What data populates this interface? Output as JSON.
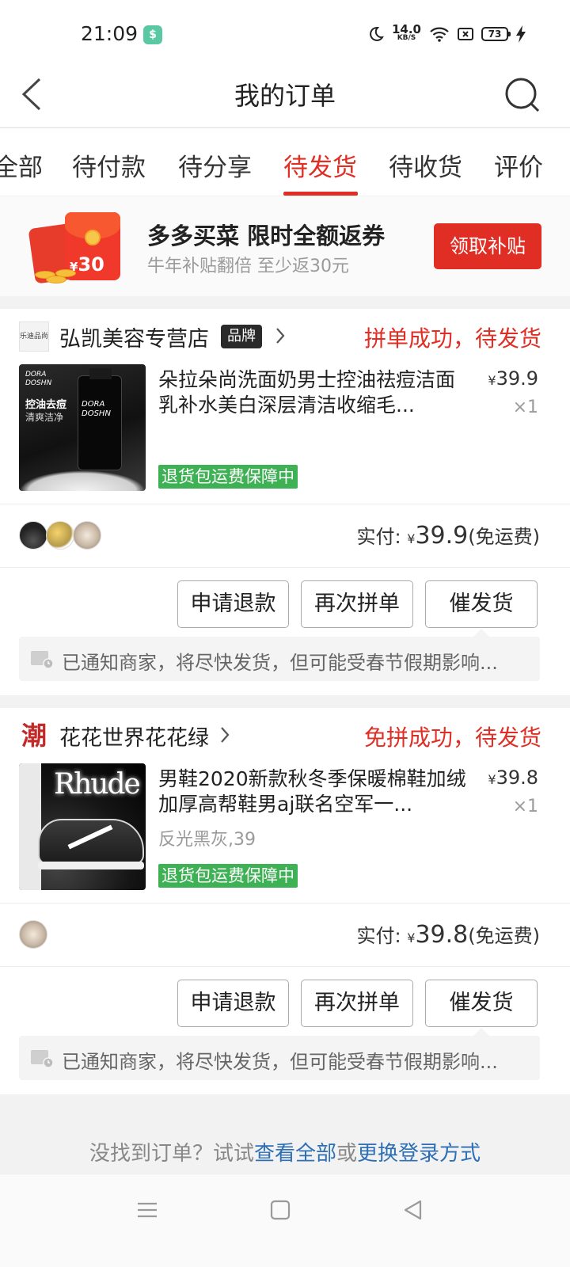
{
  "status_bar": {
    "time": "21:09",
    "net_speed": "14.0",
    "net_unit": "KB/S",
    "battery": "73"
  },
  "header": {
    "title": "我的订单"
  },
  "tabs": [
    {
      "label": "全部",
      "active": false
    },
    {
      "label": "待付款",
      "active": false
    },
    {
      "label": "待分享",
      "active": false
    },
    {
      "label": "待发货",
      "active": true
    },
    {
      "label": "待收货",
      "active": false
    },
    {
      "label": "评价",
      "active": false
    }
  ],
  "promo": {
    "title": "多多买菜 限时全额返券",
    "subtitle": "牛年补贴翻倍 至少返30元",
    "button": "领取补贴",
    "coupon_currency": "¥",
    "coupon_amount": "30"
  },
  "orders": [
    {
      "shop_name": "弘凯美容专营店",
      "shop_logo_text": "乐迪品尚",
      "brand_badge": "品牌",
      "status": "拼单成功，待发货",
      "product_title": "朵拉朵尚洗面奶男士控油祛痘洁面乳补水美白深层清洁收缩毛...",
      "product_image_text": [
        "DORA",
        "DOSHN",
        "控油去痘",
        "清爽洁净"
      ],
      "spec": "",
      "price_currency": "¥",
      "price": "39.9",
      "qty": "×1",
      "guarantee": "退货包运费保障中",
      "paid_label": "实付:",
      "paid_currency": "¥",
      "paid_amount": "39.9",
      "shipping_note": "(免运费)",
      "buttons": [
        "申请退款",
        "再次拼单",
        "催发货"
      ],
      "notice": "已通知商家，将尽快发货，但可能受春节假期影响..."
    },
    {
      "shop_name": "花花世界花花绿",
      "shop_logo_text": "潮",
      "status": "免拼成功，待发货",
      "product_title": "男鞋2020新款秋冬季保暖棉鞋加绒加厚高帮鞋男aj联名空军一...",
      "product_image_text": "Rhude",
      "spec": "反光黑灰,39",
      "price_currency": "¥",
      "price": "39.8",
      "qty": "×1",
      "guarantee": "退货包运费保障中",
      "paid_label": "实付:",
      "paid_currency": "¥",
      "paid_amount": "39.8",
      "shipping_note": "(免运费)",
      "buttons": [
        "申请退款",
        "再次拼单",
        "催发货"
      ],
      "notice": "已通知商家，将尽快发货，但可能受春节假期影响..."
    }
  ],
  "footer": {
    "prefix": "没找到订单？试试",
    "link1": "查看全部",
    "middle": "或",
    "link2": "更换登录方式"
  },
  "colors": {
    "accent": "#e02e24",
    "guarantee": "#3eb155",
    "link": "#2d6fb5"
  },
  "icons": [
    "back-icon",
    "search-icon",
    "chevron-right-icon",
    "notice-icon",
    "nav-menu-icon",
    "nav-home-icon",
    "nav-back-icon"
  ]
}
